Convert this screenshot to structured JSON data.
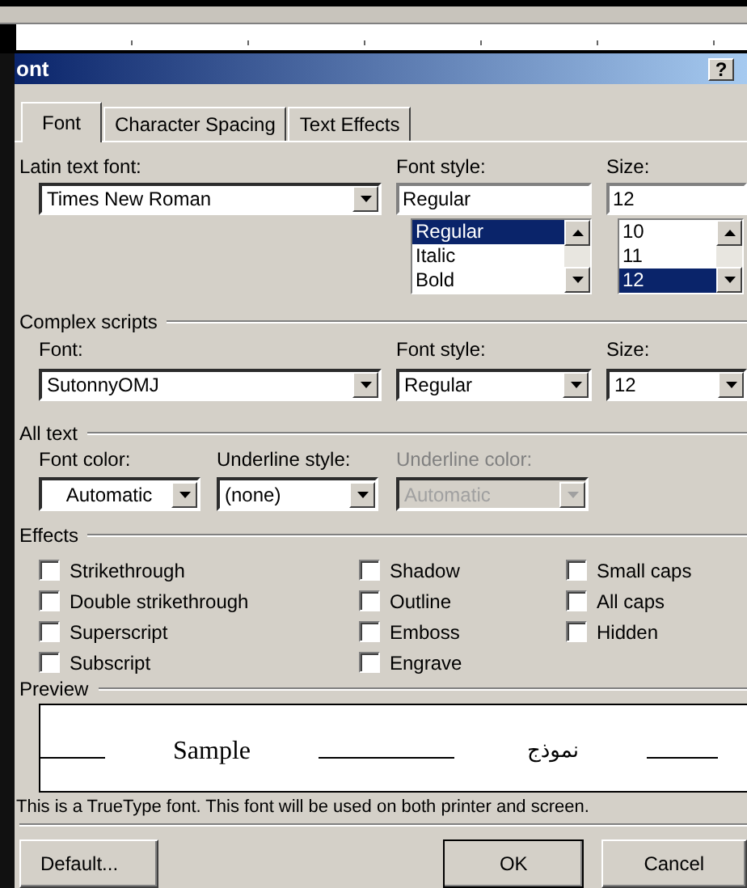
{
  "window": {
    "title": "ont",
    "help_button": "?"
  },
  "tabs": [
    {
      "label": "Font",
      "selected": true
    },
    {
      "label": "Character Spacing",
      "selected": false
    },
    {
      "label": "Text Effects",
      "selected": false
    }
  ],
  "latin_text_font": {
    "label": "Latin text font:",
    "value": "Times New Roman"
  },
  "font_style": {
    "label": "Font style:",
    "value": "Regular",
    "options": [
      {
        "label": "Regular",
        "selected": true
      },
      {
        "label": "Italic",
        "selected": false
      },
      {
        "label": "Bold",
        "selected": false
      }
    ]
  },
  "size": {
    "label": "Size:",
    "value": "12",
    "options": [
      {
        "label": "10",
        "selected": false
      },
      {
        "label": "11",
        "selected": false
      },
      {
        "label": "12",
        "selected": true
      }
    ]
  },
  "complex_scripts": {
    "heading": "Complex scripts",
    "font": {
      "label": "Font:",
      "value": "SutonnyOMJ"
    },
    "font_style": {
      "label": "Font style:",
      "value": "Regular"
    },
    "size": {
      "label": "Size:",
      "value": "12"
    }
  },
  "all_text": {
    "heading": "All text",
    "fields": [
      {
        "label": "Font color:",
        "value": "Automatic",
        "disabled": false
      },
      {
        "label": "Underline style:",
        "value": "(none)",
        "disabled": false
      },
      {
        "label": "Underline color:",
        "value": "Automatic",
        "disabled": true
      }
    ]
  },
  "effects": {
    "heading": "Effects",
    "columns": [
      [
        {
          "label": "Strikethrough",
          "checked": false
        },
        {
          "label": "Double strikethrough",
          "checked": false
        },
        {
          "label": "Superscript",
          "checked": false
        },
        {
          "label": "Subscript",
          "checked": false
        }
      ],
      [
        {
          "label": "Shadow",
          "checked": false
        },
        {
          "label": "Outline",
          "checked": false
        },
        {
          "label": "Emboss",
          "checked": false
        },
        {
          "label": "Engrave",
          "checked": false
        }
      ],
      [
        {
          "label": "Small caps",
          "checked": false
        },
        {
          "label": "All caps",
          "checked": false
        },
        {
          "label": "Hidden",
          "checked": false
        }
      ]
    ]
  },
  "preview": {
    "heading": "Preview",
    "latin_sample": "Sample",
    "complex_sample": "نموذج"
  },
  "note": "This is a TrueType font. This font will be used on both printer and screen.",
  "buttons": [
    {
      "label": "Default...",
      "kind": "left"
    },
    {
      "label": "OK",
      "kind": "right"
    },
    {
      "label": "Cancel",
      "kind": "right"
    }
  ]
}
